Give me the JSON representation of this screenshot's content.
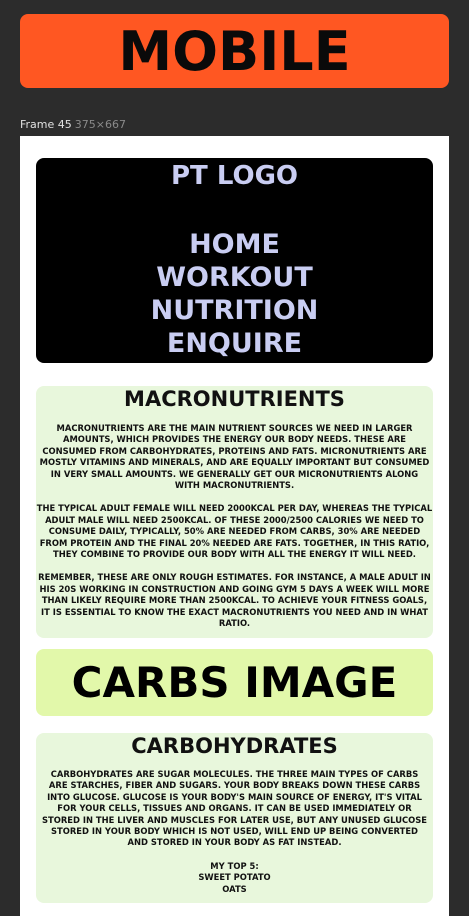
{
  "header": {
    "title": "MOBILE"
  },
  "frame": {
    "name": "Frame 45",
    "size": "375×667"
  },
  "nav": {
    "logo": "PT LOGO",
    "links": [
      "HOME",
      "WORKOUT",
      "NUTRITION",
      "ENQUIRE"
    ]
  },
  "macronutrients": {
    "heading": "MACRONUTRIENTS",
    "para1": "MACRONUTRIENTS ARE THE MAIN NUTRIENT SOURCES WE NEED IN LARGER AMOUNTS, WHICH PROVIDES THE ENERGY OUR BODY NEEDS. THESE ARE CONSUMED FROM CARBOHYDRATES, PROTEINS AND FATS. MICRONUTRIENTS ARE MOSTLY VITAMINS AND MINERALS, AND ARE EQUALLY IMPORTANT BUT CONSUMED IN VERY SMALL AMOUNTS. WE GENERALLY GET OUR MICRONUTRIENTS ALONG WITH MACRONUTRIENTS.",
    "para2": "THE TYPICAL ADULT FEMALE WILL NEED 2000KCAL PER DAY, WHEREAS THE TYPICAL ADULT MALE WILL NEED 2500KCAL. OF THESE 2000/2500 CALORIES WE NEED TO CONSUME DAILY, TYPICALLY, 50% ARE NEEDED FROM CARBS, 30% ARE NEEDED FROM PROTEIN AND THE FINAL 20% NEEDED ARE FATS. TOGETHER, IN THIS RATIO, THEY COMBINE TO PROVIDE OUR BODY WITH ALL THE ENERGY IT WILL NEED.",
    "para3": "REMEMBER, THESE ARE ONLY ROUGH ESTIMATES. FOR INSTANCE, A MALE ADULT IN HIS 20S WORKING IN CONSTRUCTION AND GOING GYM 5 DAYS A WEEK WILL MORE THAN LIKELY REQUIRE MORE THAN 2500KCAL. TO ACHIEVE YOUR FITNESS GOALS, IT IS ESSENTIAL TO KNOW THE EXACT MACRONUTRIENTS YOU NEED AND IN WHAT RATIO."
  },
  "carbs_image": {
    "label": "CARBS IMAGE"
  },
  "carbohydrates": {
    "heading": "CARBOHYDRATES",
    "para1": "CARBOHYDRATES ARE SUGAR MOLECULES. THE THREE MAIN TYPES OF CARBS ARE STARCHES, FIBER AND SUGARS. YOUR BODY BREAKS DOWN THESE CARBS INTO GLUCOSE. GLUCOSE IS YOUR BODY'S MAIN SOURCE OF ENERGY, IT'S VITAL FOR YOUR CELLS, TISSUES AND ORGANS. IT CAN BE USED IMMEDIATELY OR STORED IN THE LIVER AND MUSCLES FOR LATER USE, BUT ANY UNUSED GLUCOSE STORED IN YOUR BODY WHICH IS NOT USED, WILL END UP BEING CONVERTED AND STORED IN YOUR BODY AS FAT INSTEAD.",
    "top_heading": "MY TOP 5:",
    "top_items": [
      "SWEET POTATO",
      "OATS"
    ]
  }
}
